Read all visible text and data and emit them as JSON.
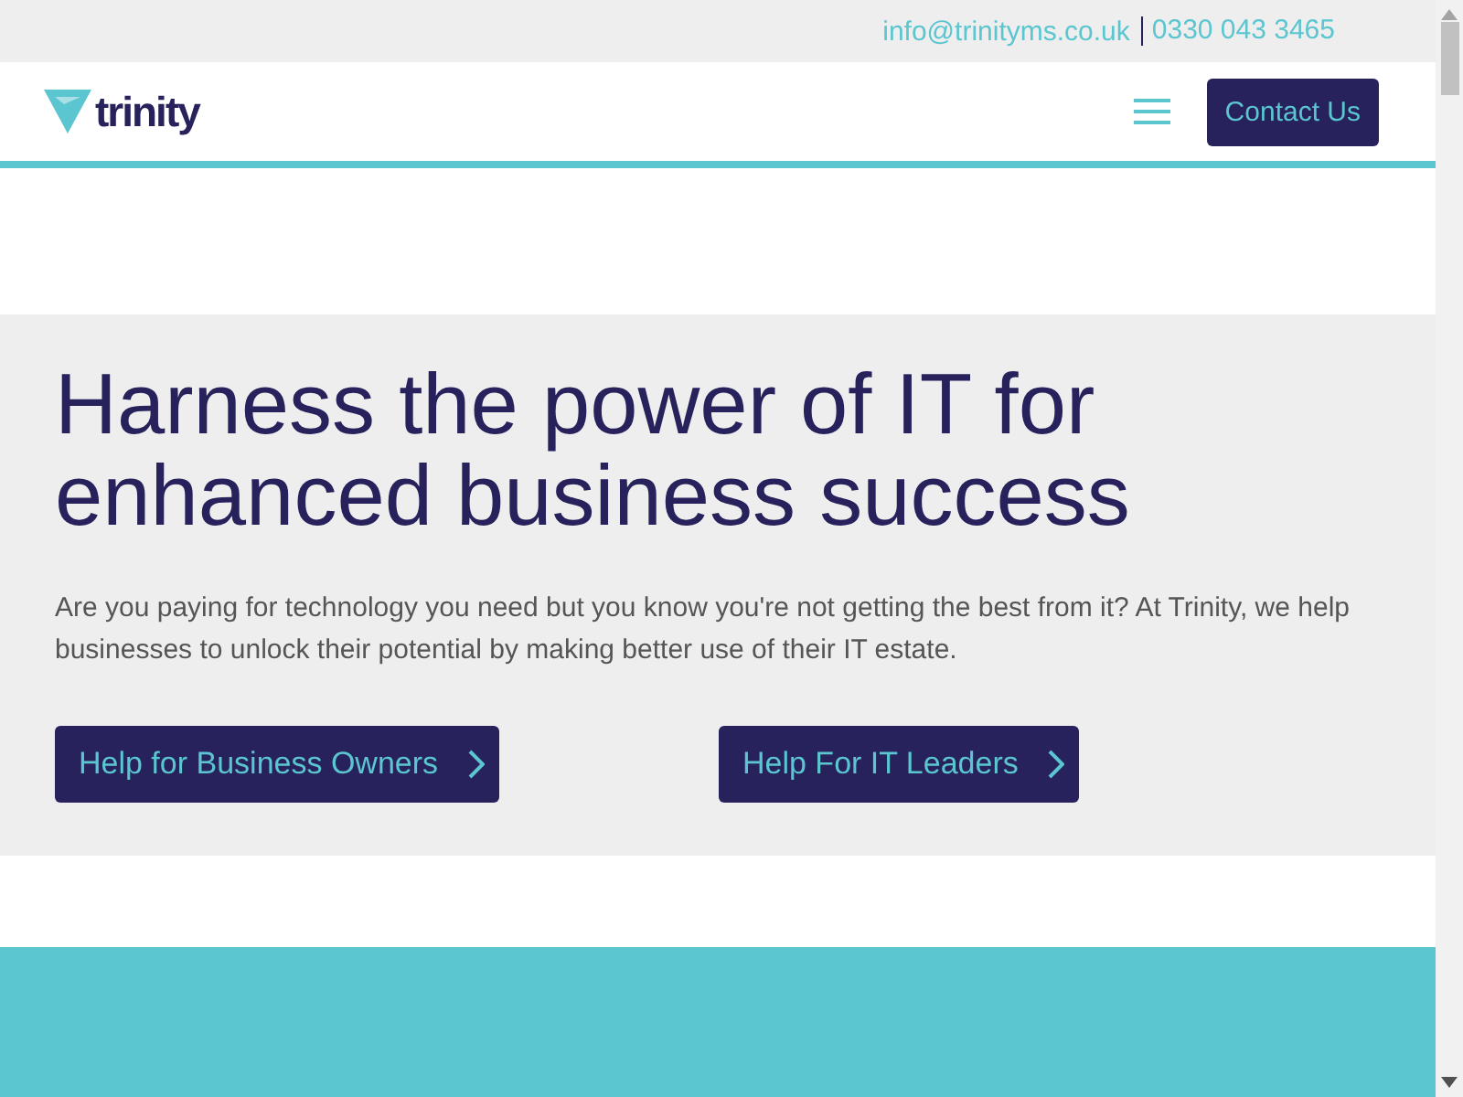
{
  "top_bar": {
    "email": "info@trinityms.co.uk",
    "phone": "0330 043 3465"
  },
  "header": {
    "logo_text": "trinity",
    "contact_button": "Contact Us"
  },
  "hero": {
    "title": "Harness the power of IT for enhanced business success",
    "body": "Are you paying for technology you need but you know you're not getting the best from it? At Trinity, we help businesses to unlock their potential by making better use of their IT estate.",
    "buttons": [
      {
        "label": "Help for Business Owners"
      },
      {
        "label": "Help For IT Leaders"
      }
    ]
  }
}
